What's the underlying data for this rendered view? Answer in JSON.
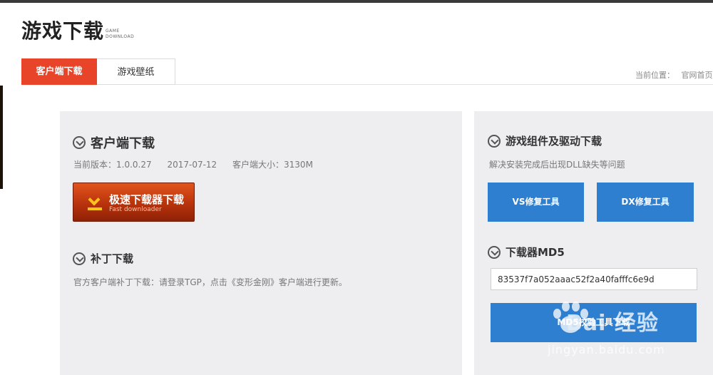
{
  "header": {
    "title": "游戏下载",
    "subtitle_line1": "GAME",
    "subtitle_line2": "DOWNLOAD"
  },
  "tabs": [
    {
      "label": "客户端下载",
      "active": true
    },
    {
      "label": "游戏壁纸",
      "active": false
    }
  ],
  "breadcrumb": {
    "prefix": "当前位置：",
    "home": "官网首页"
  },
  "client": {
    "title": "客户端下载",
    "version": "当前版本：1.0.0.27",
    "date": "2017-07-12",
    "size": "客户端大小：3130M",
    "download_main": "极速下载器下载",
    "download_sub": "Fast downloader"
  },
  "patch": {
    "title": "补丁下载",
    "description": "官方客户端补丁下载：请登录TGP，点击《变形金刚》客户端进行更新。"
  },
  "components": {
    "title": "游戏组件及驱动下载",
    "description": "解决安装完成后出现DLL缺失等问题",
    "vs_label": "VS修复工具",
    "dx_label": "DX修复工具"
  },
  "md5": {
    "title": "下载器MD5",
    "value": "83537f7a052aaac52f2a40fafffc6e9d",
    "button_label": "MD5校验工具下载"
  },
  "watermark": {
    "text": "Bai 经验",
    "url": "jingyan.baidu.com"
  },
  "colors": {
    "accent_red": "#e8442a",
    "accent_blue": "#2f7fd0",
    "panel_bg": "#eeeef0"
  }
}
